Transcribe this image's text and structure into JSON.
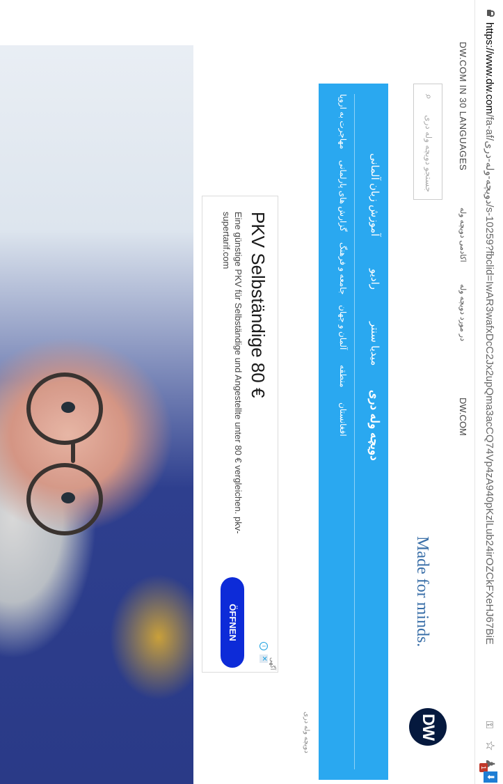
{
  "browser": {
    "url_host": "https://www.dw.com",
    "url_path": "/fa-af/دویچه-وله-دری/s-10259?fbclid=IwAR3wafxDcC2Jx2upQma3acCQ74Vp4zA940pKzlLub24irOZCkFXeHJ67BiE",
    "icons": [
      "lock-icon",
      "key-icon",
      "star-icon",
      "extension-icon",
      "download-icon"
    ],
    "extension_badge": "1"
  },
  "topnav": {
    "languages": "DW.COM IN 30 LANGUAGES",
    "academy": "اکادمی دویچه وله",
    "about": "در مورد دویچه وله",
    "dwcom": "DW.COM"
  },
  "header": {
    "search_placeholder": "جستجو دویچه وله دری",
    "tagline": "Made for minds.",
    "logo": "DW"
  },
  "nav": {
    "main": [
      "دویچه وله دری",
      "میدیا سنتر",
      "رادیو",
      "آموزش زبان آلمانی"
    ],
    "sub": [
      "افغانستان",
      "منطقه",
      "آلمان و جهان",
      "جامعه و فرهنگ",
      "گزارش های پارلمانی",
      "مهاجرت به اروپا"
    ]
  },
  "breadcrumb": "دویچه وله دری",
  "ad": {
    "label": "آگهی",
    "title": "PKV Selbständige 80 €",
    "description": "Eine günstige PKV für Selbständige und Angestellte unter 80 € vergleichen. pkv-supertarif.com",
    "cta": "ÖFFNEN"
  },
  "colors": {
    "nav_blue": "#2aa8f0",
    "logo_navy": "#05193e",
    "cta_blue": "#0d2bd8",
    "tagline_blue": "#3a6fa8"
  }
}
